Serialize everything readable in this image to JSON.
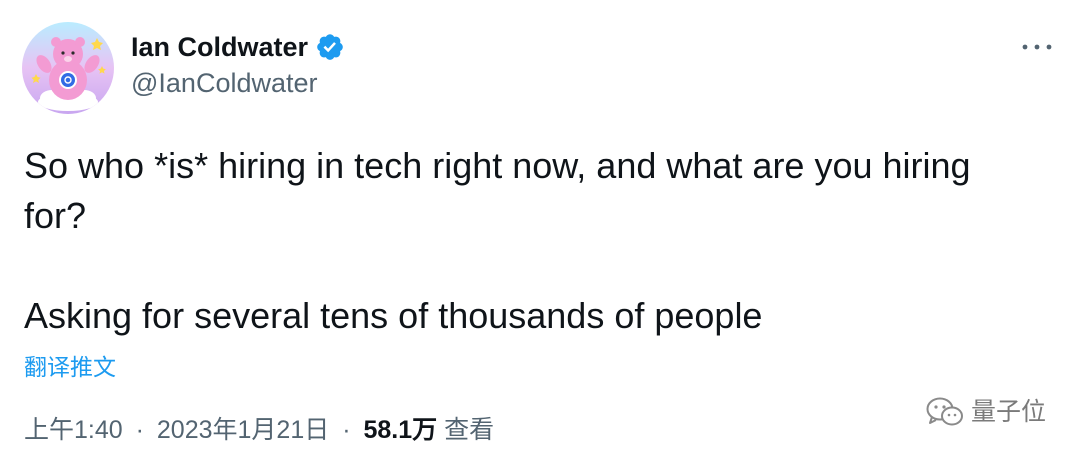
{
  "author": {
    "display_name": "Ian Coldwater",
    "handle": "@IanColdwater",
    "verified": true
  },
  "tweet": {
    "line1": "So who *is* hiring in tech right now, and what are you hiring for?",
    "line2": "Asking for several tens of thousands of people",
    "translate_label": "翻译推文"
  },
  "meta": {
    "time": "上午1:40",
    "separator": "·",
    "date": "2023年1月21日",
    "views_count": "58.1万",
    "views_label": "查看"
  },
  "watermark": {
    "text": "量子位"
  },
  "icons": {
    "verified": "verified-badge-icon",
    "more": "more-options-icon",
    "watermark_logo": "wechat-logo-icon"
  },
  "colors": {
    "verified": "#1d9bf0",
    "link": "#1d9bf0",
    "secondary_text": "#536471",
    "primary_text": "#0f1419"
  }
}
